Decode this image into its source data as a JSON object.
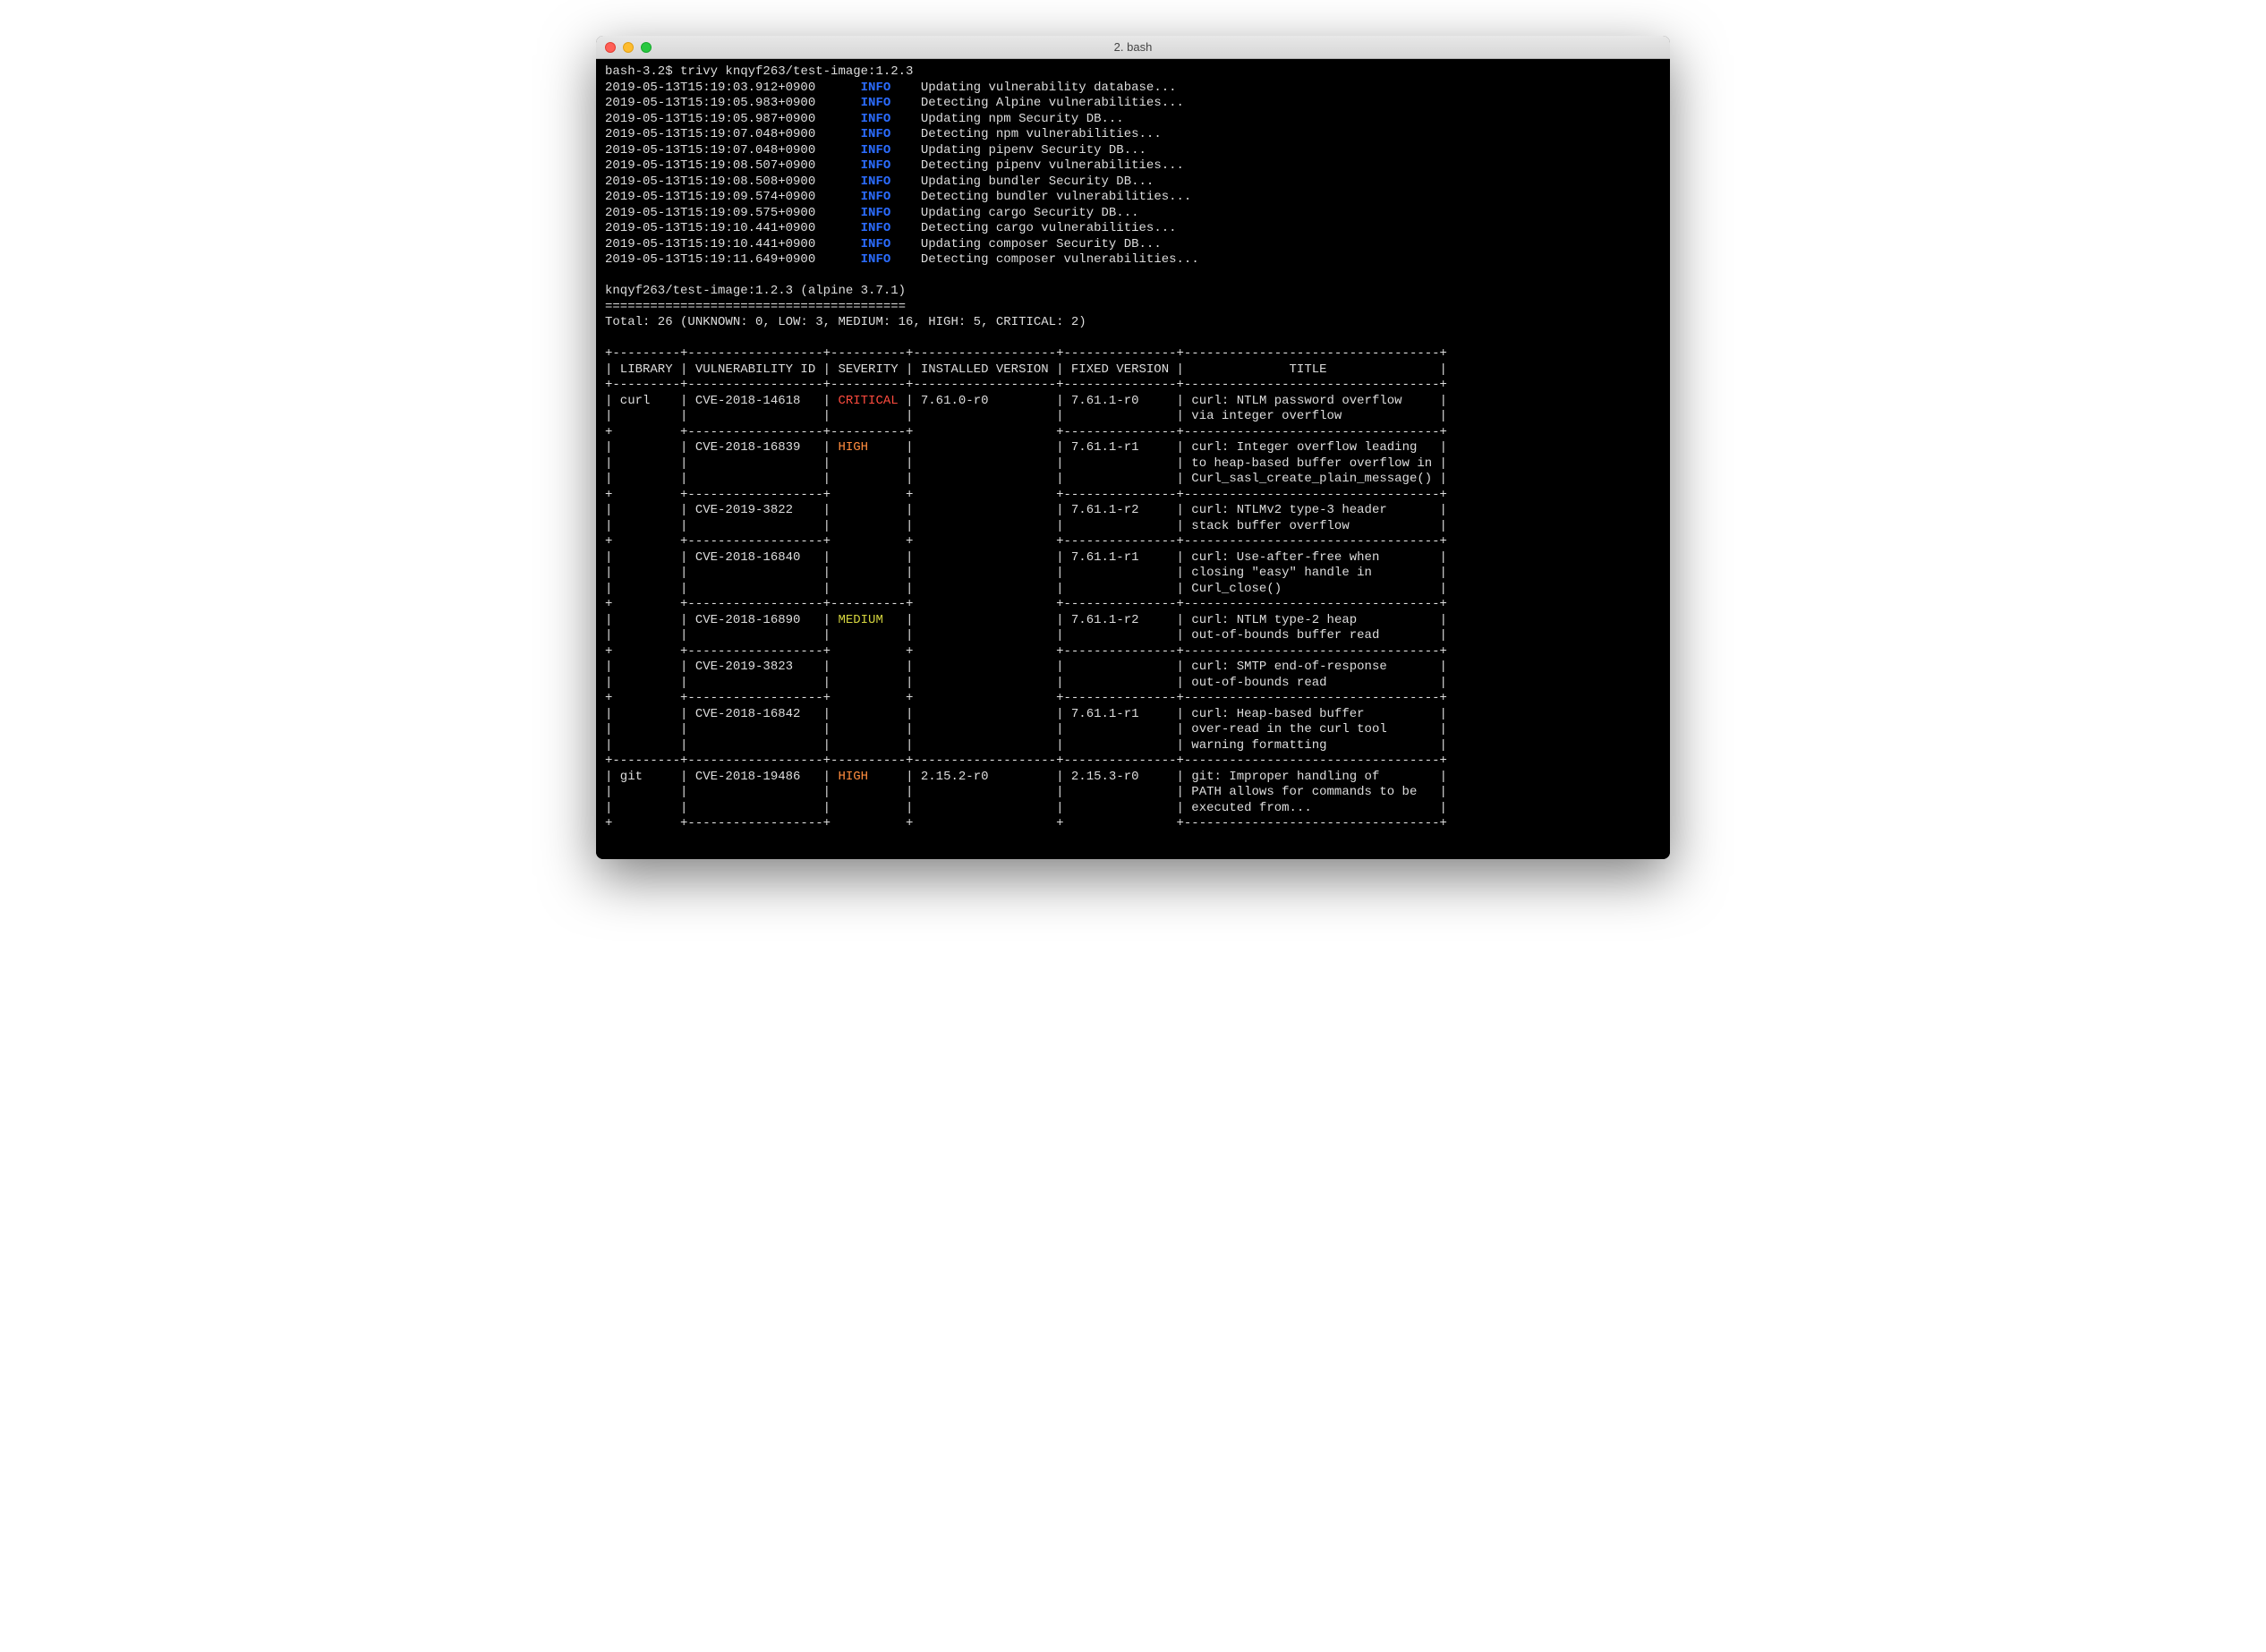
{
  "window": {
    "title": "2. bash"
  },
  "prompt": "bash-3.2$ ",
  "command": "trivy knqyf263/test-image:1.2.3",
  "log_lines": [
    {
      "ts": "2019-05-13T15:19:03.912+0900",
      "level": "INFO",
      "msg": "Updating vulnerability database..."
    },
    {
      "ts": "2019-05-13T15:19:05.983+0900",
      "level": "INFO",
      "msg": "Detecting Alpine vulnerabilities..."
    },
    {
      "ts": "2019-05-13T15:19:05.987+0900",
      "level": "INFO",
      "msg": "Updating npm Security DB..."
    },
    {
      "ts": "2019-05-13T15:19:07.048+0900",
      "level": "INFO",
      "msg": "Detecting npm vulnerabilities..."
    },
    {
      "ts": "2019-05-13T15:19:07.048+0900",
      "level": "INFO",
      "msg": "Updating pipenv Security DB..."
    },
    {
      "ts": "2019-05-13T15:19:08.507+0900",
      "level": "INFO",
      "msg": "Detecting pipenv vulnerabilities..."
    },
    {
      "ts": "2019-05-13T15:19:08.508+0900",
      "level": "INFO",
      "msg": "Updating bundler Security DB..."
    },
    {
      "ts": "2019-05-13T15:19:09.574+0900",
      "level": "INFO",
      "msg": "Detecting bundler vulnerabilities..."
    },
    {
      "ts": "2019-05-13T15:19:09.575+0900",
      "level": "INFO",
      "msg": "Updating cargo Security DB..."
    },
    {
      "ts": "2019-05-13T15:19:10.441+0900",
      "level": "INFO",
      "msg": "Detecting cargo vulnerabilities..."
    },
    {
      "ts": "2019-05-13T15:19:10.441+0900",
      "level": "INFO",
      "msg": "Updating composer Security DB..."
    },
    {
      "ts": "2019-05-13T15:19:11.649+0900",
      "level": "INFO",
      "msg": "Detecting composer vulnerabilities..."
    }
  ],
  "report_header": "knqyf263/test-image:1.2.3 (alpine 3.7.1)",
  "totals_line": "Total: 26 (UNKNOWN: 0, LOW: 3, MEDIUM: 16, HIGH: 5, CRITICAL: 2)",
  "table": {
    "headers": [
      "LIBRARY",
      "VULNERABILITY ID",
      "SEVERITY",
      "INSTALLED VERSION",
      "FIXED VERSION",
      "TITLE"
    ],
    "rows": [
      {
        "library": "curl",
        "vuln_id": "CVE-2018-14618",
        "severity": "CRITICAL",
        "installed": "7.61.0-r0",
        "fixed": "7.61.1-r0",
        "title": [
          "curl: NTLM password overflow",
          "via integer overflow"
        ]
      },
      {
        "library": "",
        "vuln_id": "CVE-2018-16839",
        "severity": "HIGH",
        "installed": "",
        "fixed": "7.61.1-r1",
        "title": [
          "curl: Integer overflow leading",
          "to heap-based buffer overflow in",
          "Curl_sasl_create_plain_message()"
        ]
      },
      {
        "library": "",
        "vuln_id": "CVE-2019-3822",
        "severity": "",
        "installed": "",
        "fixed": "7.61.1-r2",
        "title": [
          "curl: NTLMv2 type-3 header",
          "stack buffer overflow"
        ]
      },
      {
        "library": "",
        "vuln_id": "CVE-2018-16840",
        "severity": "",
        "installed": "",
        "fixed": "7.61.1-r1",
        "title": [
          "curl: Use-after-free when",
          "closing \"easy\" handle in",
          "Curl_close()"
        ]
      },
      {
        "library": "",
        "vuln_id": "CVE-2018-16890",
        "severity": "MEDIUM",
        "installed": "",
        "fixed": "7.61.1-r2",
        "title": [
          "curl: NTLM type-2 heap",
          "out-of-bounds buffer read"
        ]
      },
      {
        "library": "",
        "vuln_id": "CVE-2019-3823",
        "severity": "",
        "installed": "",
        "fixed": "",
        "title": [
          "curl: SMTP end-of-response",
          "out-of-bounds read"
        ]
      },
      {
        "library": "",
        "vuln_id": "CVE-2018-16842",
        "severity": "",
        "installed": "",
        "fixed": "7.61.1-r1",
        "title": [
          "curl: Heap-based buffer",
          "over-read in the curl tool",
          "warning formatting"
        ]
      },
      {
        "library": "git",
        "vuln_id": "CVE-2018-19486",
        "severity": "HIGH",
        "installed": "2.15.2-r0",
        "fixed": "2.15.3-r0",
        "title": [
          "git: Improper handling of",
          "PATH allows for commands to be",
          "executed from..."
        ]
      }
    ],
    "col_widths": {
      "library": 9,
      "vuln_id": 18,
      "severity": 10,
      "installed": 19,
      "fixed": 15,
      "title": 34
    }
  }
}
